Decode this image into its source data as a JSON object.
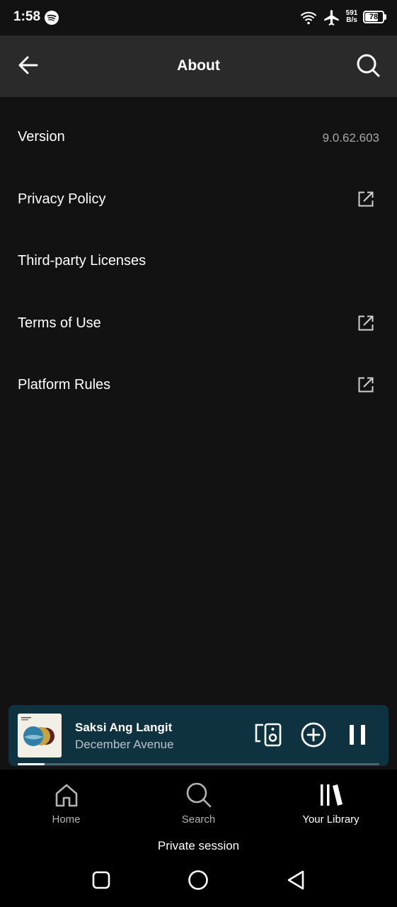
{
  "status_bar": {
    "time": "1:58",
    "net_speed_value": "591",
    "net_speed_unit": "B/s",
    "battery_level": "78",
    "battery_fraction": 0.78,
    "icons": [
      "spotify-icon",
      "wifi-icon",
      "airplane-mode-icon",
      "battery-icon"
    ]
  },
  "header": {
    "title": "About",
    "back_icon": "arrow-left-icon",
    "search_icon": "search-icon"
  },
  "settings": {
    "items": [
      {
        "label": "Version",
        "value": "9.0.62.603"
      },
      {
        "label": "Privacy Policy",
        "icon": "external-link-icon"
      },
      {
        "label": "Third-party Licenses"
      },
      {
        "label": "Terms of Use",
        "icon": "external-link-icon"
      },
      {
        "label": "Platform Rules",
        "icon": "external-link-icon"
      }
    ]
  },
  "mini_player": {
    "track_title": "Saksi Ang Langit",
    "artist": "December Avenue",
    "progress": 0.075,
    "background_color": "#0f3241",
    "icons": [
      "connect-device-icon",
      "add-circle-icon",
      "pause-icon"
    ]
  },
  "bottom_nav": {
    "tabs": [
      {
        "label": "Home",
        "icon": "home-icon",
        "active": false
      },
      {
        "label": "Search",
        "icon": "search-icon",
        "active": false
      },
      {
        "label": "Your Library",
        "icon": "library-icon",
        "active": true
      }
    ]
  },
  "private_session": "Private session",
  "system_nav": {
    "icons": [
      "recents-icon",
      "home-circle-icon",
      "back-triangle-icon"
    ]
  },
  "colors": {
    "background": "#121212",
    "header": "#2a2a2a",
    "secondary_text": "#a7a7a7"
  }
}
